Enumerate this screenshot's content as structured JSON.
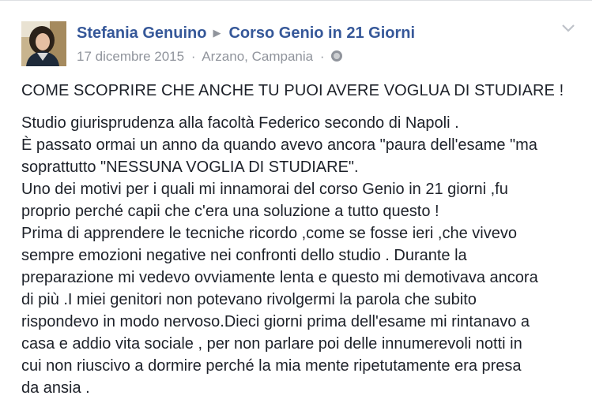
{
  "post": {
    "author": "Stefania Genuino",
    "target": "Corso Genio in 21 Giorni",
    "date": "17 dicembre 2015",
    "location": "Arzano, Campania",
    "separator": "·",
    "privacy_icon": "globe-icon",
    "menu_icon": "chevron-down-icon",
    "headline": "COME SCOPRIRE CHE ANCHE TU PUOI AVERE VOGLUA DI STUDIARE !",
    "body_lines": [
      "Studio giurisprudenza alla facoltà Federico secondo di Napoli .",
      "È passato ormai un anno da quando avevo ancora \"paura dell'esame \"ma",
      "soprattutto \"NESSUNA VOGLIA DI STUDIARE\".",
      "Uno dei motivi per i quali mi innamorai del corso Genio in 21 giorni ,fu",
      "proprio perché capii che c'era una soluzione a tutto questo !",
      "Prima di apprendere le tecniche ricordo ,come se fosse ieri ,che vivevo",
      "sempre emozioni negative nei confronti dello studio . Durante la",
      "preparazione mi vedevo ovviamente lenta e questo mi demotivava ancora",
      "di più .I miei genitori non potevano rivolgermi la parola che subito",
      "rispondevo in modo nervoso.Dieci giorni prima dell'esame mi rintanavo a",
      "casa e addio vita sociale , per non parlare poi delle innumerevoli notti in",
      "cui non riuscivo a dormire perché la mia mente ripetutamente era presa",
      "da ansia ."
    ]
  },
  "colors": {
    "link": "#365899",
    "meta": "#90949c",
    "text": "#1d2129"
  }
}
